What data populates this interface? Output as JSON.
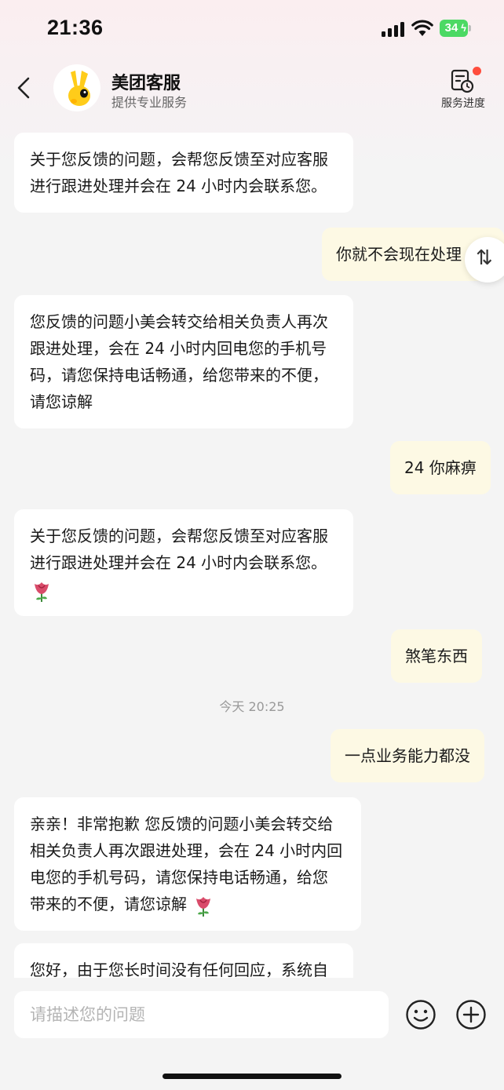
{
  "status_bar": {
    "time": "21:36",
    "battery": "34",
    "icons": [
      "cellular-signal-icon",
      "wifi-icon",
      "battery-charging-icon"
    ]
  },
  "header": {
    "title": "美团客服",
    "subtitle": "提供专业服务",
    "progress_label": "服务进度",
    "icons": [
      "back-icon",
      "mascot-avatar",
      "service-progress-icon"
    ]
  },
  "messages": [
    {
      "side": "agent",
      "lines": [
        "关于您反馈的问题，会帮您反馈至对应客服",
        "进行跟进处理并会在 24 小时内会联系您。"
      ]
    },
    {
      "side": "user",
      "text": "你就不会现在处理"
    },
    {
      "side": "agent",
      "lines": [
        "您反馈的问题小美会转交给相关负责人再次",
        "跟进处理，会在 24 小时内回电您的手机号",
        "码，请您保持电话畅通，给您带来的不便，",
        "请您谅解"
      ]
    },
    {
      "side": "user",
      "text": "24 你麻痹"
    },
    {
      "side": "agent",
      "lines": [
        "关于您反馈的问题，会帮您反馈至对应客服",
        "进行跟进处理并会在 24 小时内会联系您。"
      ],
      "emoji": "rose-emoji"
    },
    {
      "side": "user",
      "text": "煞笔东西"
    },
    {
      "side": "user",
      "text": "一点业务能力都没"
    },
    {
      "side": "agent",
      "lines": [
        "亲亲！非常抱歉 您反馈的问题小美会转交给",
        "相关负责人再次跟进处理，会在 24 小时内回",
        "电您的手机号码，请您保持电话畅通，给您",
        "带来的不便，请您谅解"
      ],
      "emoji": "rose-emoji"
    },
    {
      "side": "agent",
      "lines": [
        "您好，由于您长时间没有任何回应，系统自"
      ]
    }
  ],
  "timestamp": "今天 20:25",
  "swap_icon_text": "⇅",
  "input": {
    "placeholder": "请描述您的问题",
    "icons": [
      "emoji-icon",
      "add-icon"
    ]
  },
  "colors": {
    "user_bubble": "#fdf9e4",
    "agent_bubble": "#ffffff",
    "background": "#f4f4f4",
    "badge": "#ff4d3d",
    "battery": "#4cd964"
  }
}
